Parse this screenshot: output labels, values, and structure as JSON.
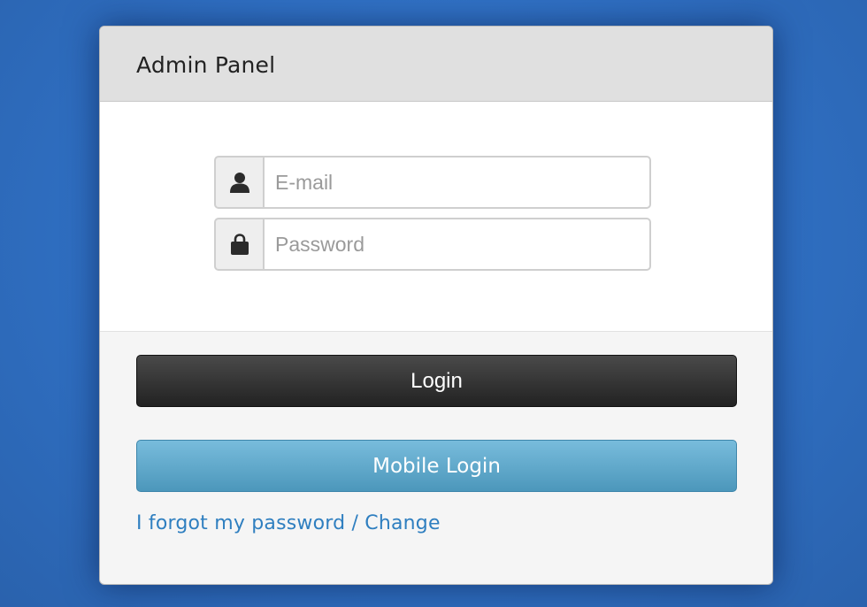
{
  "header": {
    "title": "Admin Panel"
  },
  "form": {
    "email": {
      "icon": "user-icon",
      "value": "",
      "placeholder": "E-mail"
    },
    "password": {
      "icon": "lock-icon",
      "value": "",
      "placeholder": "Password"
    }
  },
  "actions": {
    "login_label": "Login",
    "mobile_login_label": "Mobile Login",
    "forgot_link": "I forgot my password / Change"
  },
  "colors": {
    "background": "#2f6fc2",
    "login_button": "#2b2b2b",
    "mobile_button": "#5fa8cc",
    "link": "#2f7fc0"
  }
}
